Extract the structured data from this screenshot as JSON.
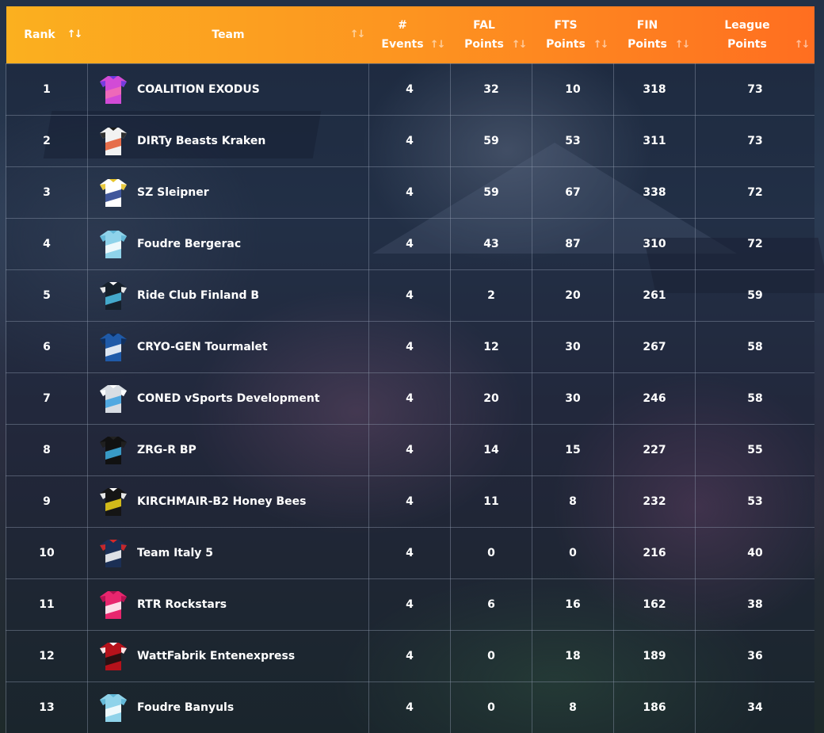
{
  "header": {
    "rank": [
      "Rank"
    ],
    "team": [
      "Team"
    ],
    "events": [
      "#",
      "Events"
    ],
    "fal": [
      "FAL",
      "Points"
    ],
    "fts": [
      "FTS",
      "Points"
    ],
    "fin": [
      "FIN",
      "Points"
    ],
    "league": [
      "League",
      "Points"
    ],
    "sort_glyph": "↑↓"
  },
  "rows": [
    {
      "rank": "1",
      "team": "COALITION EXODUS",
      "events": "4",
      "fal": "32",
      "fts": "10",
      "fin": "318",
      "league": "73",
      "jersey": {
        "main": "#d24bd6",
        "accent": "#f36fb4",
        "trim": "#6b3be0"
      }
    },
    {
      "rank": "2",
      "team": "DIRTy Beasts Kraken",
      "events": "4",
      "fal": "59",
      "fts": "53",
      "fin": "311",
      "league": "73",
      "jersey": {
        "main": "#f2f2f2",
        "accent": "#e4572e",
        "trim": "#1a1a1a"
      }
    },
    {
      "rank": "3",
      "team": "SZ Sleipner",
      "events": "4",
      "fal": "59",
      "fts": "67",
      "fin": "338",
      "league": "72",
      "jersey": {
        "main": "#ffffff",
        "accent": "#1e3a8a",
        "trim": "#e7c42a"
      }
    },
    {
      "rank": "4",
      "team": "Foudre Bergerac",
      "events": "4",
      "fal": "43",
      "fts": "87",
      "fin": "310",
      "league": "72",
      "jersey": {
        "main": "#8fd3ea",
        "accent": "#ffffff",
        "trim": "#5fb6d6"
      }
    },
    {
      "rank": "5",
      "team": "Ride Club Finland B",
      "events": "4",
      "fal": "2",
      "fts": "20",
      "fin": "261",
      "league": "59",
      "jersey": {
        "main": "#16202b",
        "accent": "#4cc2e8",
        "trim": "#ffffff"
      }
    },
    {
      "rank": "6",
      "team": "CRYO-GEN Tourmalet",
      "events": "4",
      "fal": "12",
      "fts": "30",
      "fin": "267",
      "league": "58",
      "jersey": {
        "main": "#1f5aa8",
        "accent": "#ffffff",
        "trim": "#0e2a55"
      }
    },
    {
      "rank": "7",
      "team": "CONED vSports Development",
      "events": "4",
      "fal": "20",
      "fts": "30",
      "fin": "246",
      "league": "58",
      "jersey": {
        "main": "#d8dde3",
        "accent": "#3aa0e0",
        "trim": "#ffffff"
      }
    },
    {
      "rank": "8",
      "team": "ZRG-R BP",
      "events": "4",
      "fal": "14",
      "fts": "15",
      "fin": "227",
      "league": "55",
      "jersey": {
        "main": "#111111",
        "accent": "#3fb3e6",
        "trim": "#222222"
      }
    },
    {
      "rank": "9",
      "team": "KIRCHMAIR-B2 Honey Bees",
      "events": "4",
      "fal": "11",
      "fts": "8",
      "fin": "232",
      "league": "53",
      "jersey": {
        "main": "#151515",
        "accent": "#f2d61b",
        "trim": "#ffffff"
      }
    },
    {
      "rank": "10",
      "team": "Team Italy 5",
      "events": "4",
      "fal": "0",
      "fts": "0",
      "fin": "216",
      "league": "40",
      "jersey": {
        "main": "#1b2f55",
        "accent": "#ffffff",
        "trim": "#d62828"
      }
    },
    {
      "rank": "11",
      "team": "RTR Rockstars",
      "events": "4",
      "fal": "6",
      "fts": "16",
      "fin": "162",
      "league": "38",
      "jersey": {
        "main": "#e8266e",
        "accent": "#ffffff",
        "trim": "#b0104f"
      }
    },
    {
      "rank": "12",
      "team": "WattFabrik Entenexpress",
      "events": "4",
      "fal": "0",
      "fts": "18",
      "fin": "189",
      "league": "36",
      "jersey": {
        "main": "#b5121b",
        "accent": "#111111",
        "trim": "#ffffff"
      }
    },
    {
      "rank": "13",
      "team": "Foudre Banyuls",
      "events": "4",
      "fal": "0",
      "fts": "8",
      "fin": "186",
      "league": "34",
      "jersey": {
        "main": "#8fd3ea",
        "accent": "#ffffff",
        "trim": "#5fb6d6"
      }
    }
  ]
}
